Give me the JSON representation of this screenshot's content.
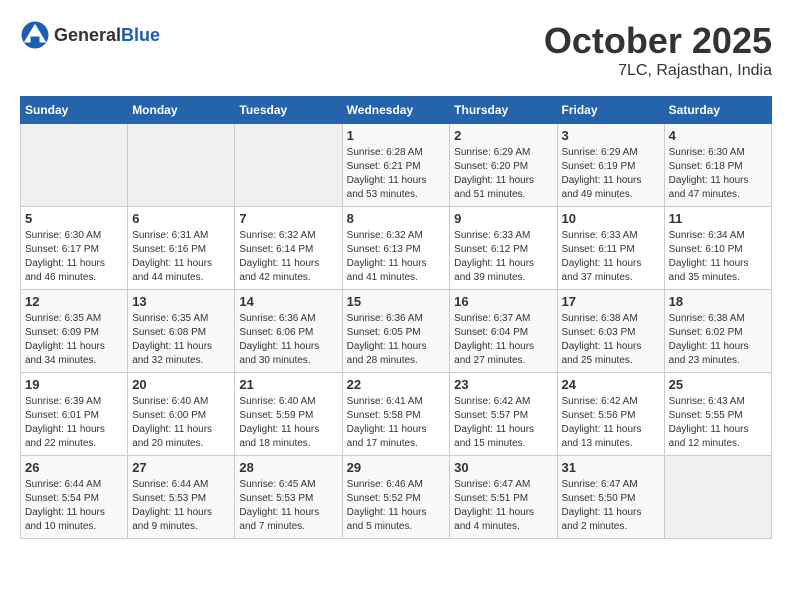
{
  "header": {
    "logo_general": "General",
    "logo_blue": "Blue",
    "month": "October 2025",
    "location": "7LC, Rajasthan, India"
  },
  "days_of_week": [
    "Sunday",
    "Monday",
    "Tuesday",
    "Wednesday",
    "Thursday",
    "Friday",
    "Saturday"
  ],
  "weeks": [
    [
      {
        "day": "",
        "info": ""
      },
      {
        "day": "",
        "info": ""
      },
      {
        "day": "",
        "info": ""
      },
      {
        "day": "1",
        "info": "Sunrise: 6:28 AM\nSunset: 6:21 PM\nDaylight: 11 hours and 53 minutes."
      },
      {
        "day": "2",
        "info": "Sunrise: 6:29 AM\nSunset: 6:20 PM\nDaylight: 11 hours and 51 minutes."
      },
      {
        "day": "3",
        "info": "Sunrise: 6:29 AM\nSunset: 6:19 PM\nDaylight: 11 hours and 49 minutes."
      },
      {
        "day": "4",
        "info": "Sunrise: 6:30 AM\nSunset: 6:18 PM\nDaylight: 11 hours and 47 minutes."
      }
    ],
    [
      {
        "day": "5",
        "info": "Sunrise: 6:30 AM\nSunset: 6:17 PM\nDaylight: 11 hours and 46 minutes."
      },
      {
        "day": "6",
        "info": "Sunrise: 6:31 AM\nSunset: 6:16 PM\nDaylight: 11 hours and 44 minutes."
      },
      {
        "day": "7",
        "info": "Sunrise: 6:32 AM\nSunset: 6:14 PM\nDaylight: 11 hours and 42 minutes."
      },
      {
        "day": "8",
        "info": "Sunrise: 6:32 AM\nSunset: 6:13 PM\nDaylight: 11 hours and 41 minutes."
      },
      {
        "day": "9",
        "info": "Sunrise: 6:33 AM\nSunset: 6:12 PM\nDaylight: 11 hours and 39 minutes."
      },
      {
        "day": "10",
        "info": "Sunrise: 6:33 AM\nSunset: 6:11 PM\nDaylight: 11 hours and 37 minutes."
      },
      {
        "day": "11",
        "info": "Sunrise: 6:34 AM\nSunset: 6:10 PM\nDaylight: 11 hours and 35 minutes."
      }
    ],
    [
      {
        "day": "12",
        "info": "Sunrise: 6:35 AM\nSunset: 6:09 PM\nDaylight: 11 hours and 34 minutes."
      },
      {
        "day": "13",
        "info": "Sunrise: 6:35 AM\nSunset: 6:08 PM\nDaylight: 11 hours and 32 minutes."
      },
      {
        "day": "14",
        "info": "Sunrise: 6:36 AM\nSunset: 6:06 PM\nDaylight: 11 hours and 30 minutes."
      },
      {
        "day": "15",
        "info": "Sunrise: 6:36 AM\nSunset: 6:05 PM\nDaylight: 11 hours and 28 minutes."
      },
      {
        "day": "16",
        "info": "Sunrise: 6:37 AM\nSunset: 6:04 PM\nDaylight: 11 hours and 27 minutes."
      },
      {
        "day": "17",
        "info": "Sunrise: 6:38 AM\nSunset: 6:03 PM\nDaylight: 11 hours and 25 minutes."
      },
      {
        "day": "18",
        "info": "Sunrise: 6:38 AM\nSunset: 6:02 PM\nDaylight: 11 hours and 23 minutes."
      }
    ],
    [
      {
        "day": "19",
        "info": "Sunrise: 6:39 AM\nSunset: 6:01 PM\nDaylight: 11 hours and 22 minutes."
      },
      {
        "day": "20",
        "info": "Sunrise: 6:40 AM\nSunset: 6:00 PM\nDaylight: 11 hours and 20 minutes."
      },
      {
        "day": "21",
        "info": "Sunrise: 6:40 AM\nSunset: 5:59 PM\nDaylight: 11 hours and 18 minutes."
      },
      {
        "day": "22",
        "info": "Sunrise: 6:41 AM\nSunset: 5:58 PM\nDaylight: 11 hours and 17 minutes."
      },
      {
        "day": "23",
        "info": "Sunrise: 6:42 AM\nSunset: 5:57 PM\nDaylight: 11 hours and 15 minutes."
      },
      {
        "day": "24",
        "info": "Sunrise: 6:42 AM\nSunset: 5:56 PM\nDaylight: 11 hours and 13 minutes."
      },
      {
        "day": "25",
        "info": "Sunrise: 6:43 AM\nSunset: 5:55 PM\nDaylight: 11 hours and 12 minutes."
      }
    ],
    [
      {
        "day": "26",
        "info": "Sunrise: 6:44 AM\nSunset: 5:54 PM\nDaylight: 11 hours and 10 minutes."
      },
      {
        "day": "27",
        "info": "Sunrise: 6:44 AM\nSunset: 5:53 PM\nDaylight: 11 hours and 9 minutes."
      },
      {
        "day": "28",
        "info": "Sunrise: 6:45 AM\nSunset: 5:53 PM\nDaylight: 11 hours and 7 minutes."
      },
      {
        "day": "29",
        "info": "Sunrise: 6:46 AM\nSunset: 5:52 PM\nDaylight: 11 hours and 5 minutes."
      },
      {
        "day": "30",
        "info": "Sunrise: 6:47 AM\nSunset: 5:51 PM\nDaylight: 11 hours and 4 minutes."
      },
      {
        "day": "31",
        "info": "Sunrise: 6:47 AM\nSunset: 5:50 PM\nDaylight: 11 hours and 2 minutes."
      },
      {
        "day": "",
        "info": ""
      }
    ]
  ]
}
